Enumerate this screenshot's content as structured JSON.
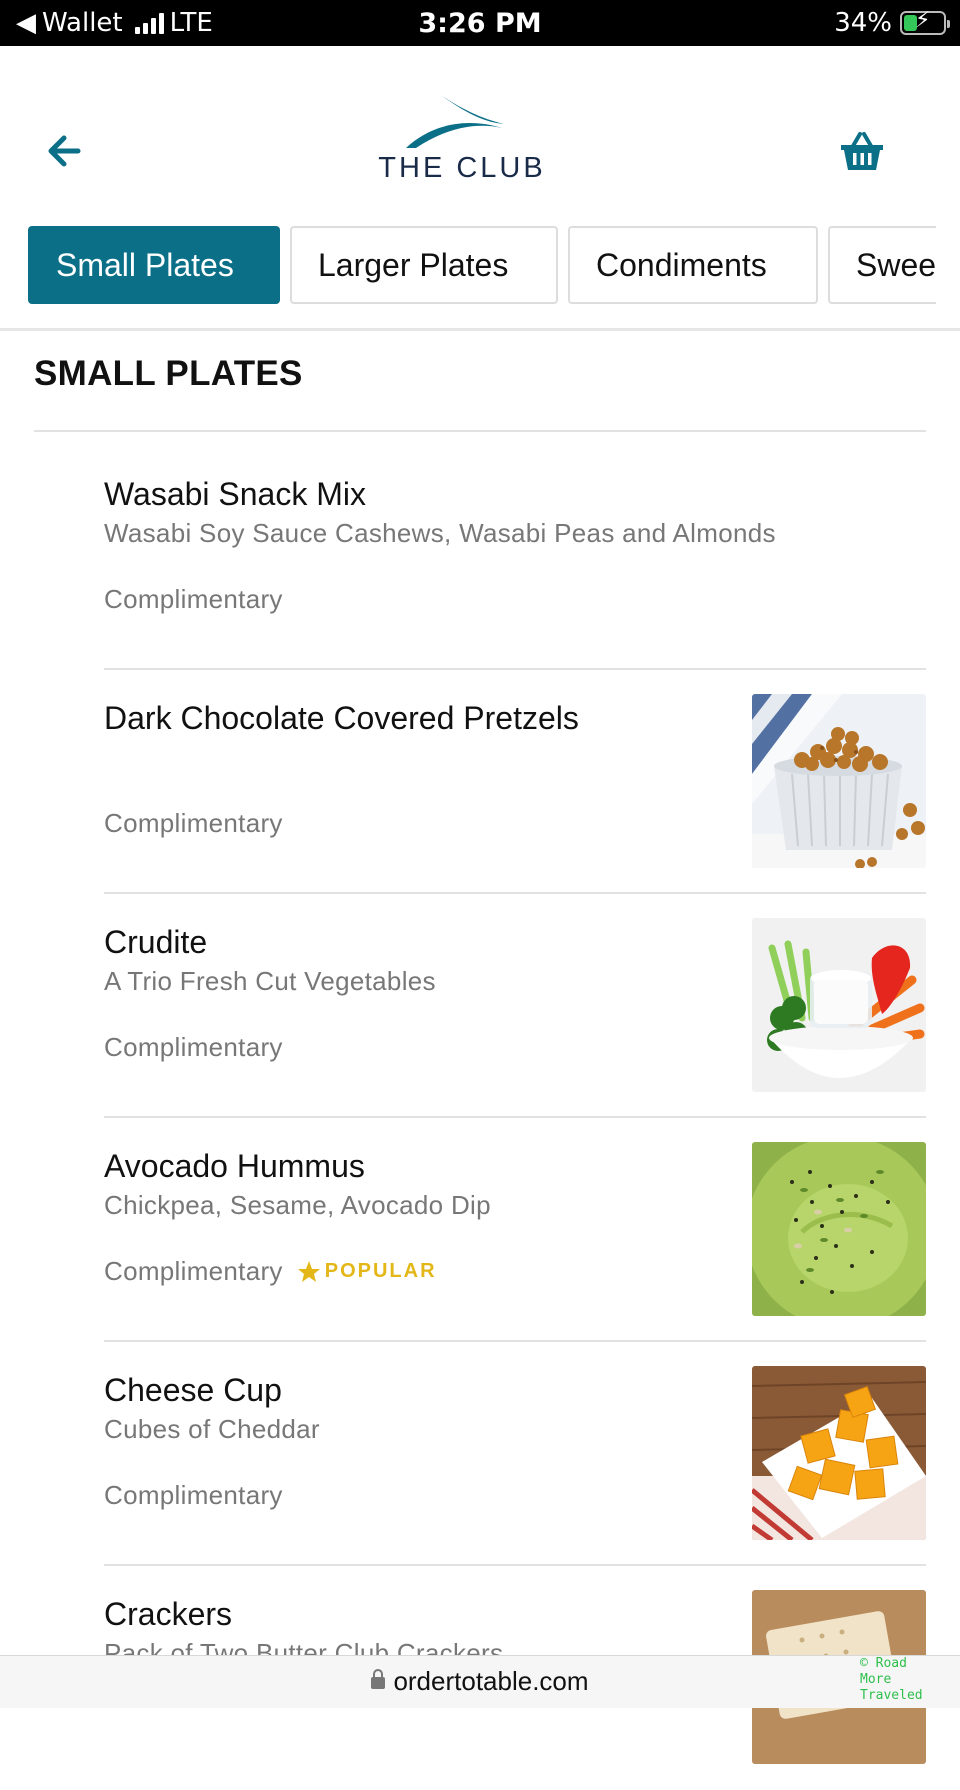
{
  "status_bar": {
    "carrier_back": "Wallet",
    "network": "LTE",
    "time": "3:26 PM",
    "battery": "34%",
    "battery_level": 0.34
  },
  "header": {
    "logo_text": "THE CLUB",
    "back_icon": "arrow-left-icon",
    "cart_icon": "basket-icon",
    "accent_color": "#0a6f87"
  },
  "tabs": [
    {
      "label": "Small Plates",
      "active": true
    },
    {
      "label": "Larger Plates",
      "active": false
    },
    {
      "label": "Condiments",
      "active": false
    },
    {
      "label": "Sweets",
      "active": false
    }
  ],
  "section": {
    "title": "SMALL PLATES"
  },
  "items": [
    {
      "name": "Wasabi Snack Mix",
      "description": "Wasabi Soy Sauce Cashews, Wasabi Peas and Almonds",
      "price": "Complimentary",
      "badge": "",
      "image": ""
    },
    {
      "name": "Dark Chocolate Covered Pretzels",
      "description": "",
      "price": "Complimentary",
      "badge": "",
      "image": "roasted-chickpeas-bowl"
    },
    {
      "name": "Crudite",
      "description": "A Trio Fresh Cut Vegetables",
      "price": "Complimentary",
      "badge": "",
      "image": "vegetables-with-dip"
    },
    {
      "name": "Avocado Hummus",
      "description": "Chickpea, Sesame, Avocado Dip",
      "price": "Complimentary",
      "badge": "POPULAR",
      "image": "green-hummus"
    },
    {
      "name": "Cheese Cup",
      "description": "Cubes of Cheddar",
      "price": "Complimentary",
      "badge": "",
      "image": "cheddar-cubes"
    },
    {
      "name": "Crackers",
      "description": "Pack of Two Butter Club Crackers",
      "price": "",
      "badge": "",
      "image": "crackers"
    }
  ],
  "browser": {
    "url": "ordertotable.com"
  },
  "watermark": "© Road\nMore\nTraveled"
}
